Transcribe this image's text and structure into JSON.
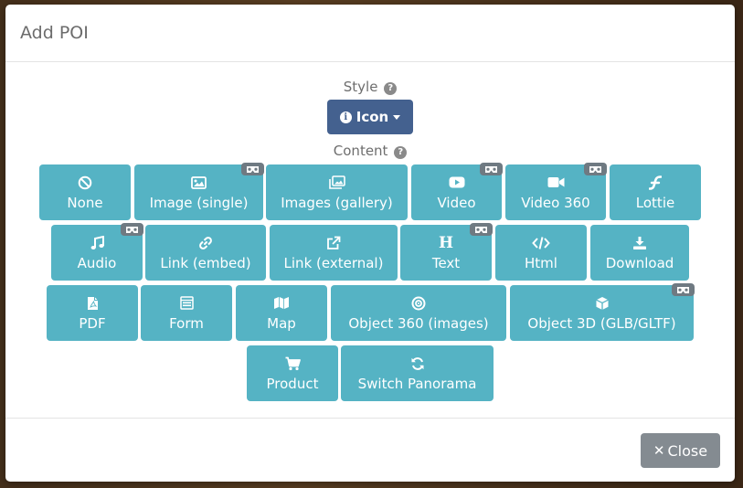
{
  "modal": {
    "title": "Add POI",
    "style_label": "Style",
    "style_button": "Icon",
    "content_label": "Content",
    "close_label": "Close"
  },
  "content_buttons": [
    {
      "label": "None",
      "icon": "ban-icon",
      "vr": false
    },
    {
      "label": "Image (single)",
      "icon": "image-icon",
      "vr": true
    },
    {
      "label": "Images (gallery)",
      "icon": "images-icon",
      "vr": false
    },
    {
      "label": "Video",
      "icon": "youtube-icon",
      "vr": true
    },
    {
      "label": "Video 360",
      "icon": "video-camera-icon",
      "vr": true
    },
    {
      "label": "Lottie",
      "icon": "lottie-icon",
      "vr": false
    },
    {
      "label": "Audio",
      "icon": "music-icon",
      "vr": true
    },
    {
      "label": "Link (embed)",
      "icon": "link-icon",
      "vr": false
    },
    {
      "label": "Link (external)",
      "icon": "external-link-icon",
      "vr": false
    },
    {
      "label": "Text",
      "icon": "heading-icon",
      "vr": true
    },
    {
      "label": "Html",
      "icon": "code-icon",
      "vr": false
    },
    {
      "label": "Download",
      "icon": "download-icon",
      "vr": false
    },
    {
      "label": "PDF",
      "icon": "pdf-file-icon",
      "vr": false
    },
    {
      "label": "Form",
      "icon": "form-icon",
      "vr": false
    },
    {
      "label": "Map",
      "icon": "map-icon",
      "vr": false
    },
    {
      "label": "Object 360 (images)",
      "icon": "object-360-icon",
      "vr": false
    },
    {
      "label": "Object 3D (GLB/GLTF)",
      "icon": "cube-icon",
      "vr": true
    },
    {
      "label": "Product",
      "icon": "cart-icon",
      "vr": false
    },
    {
      "label": "Switch Panorama",
      "icon": "sync-icon",
      "vr": false
    }
  ],
  "colors": {
    "content_button": "#55b3c4",
    "style_button": "#44618f",
    "close_button": "#848b91",
    "vr_badge": "#6f7a82"
  }
}
